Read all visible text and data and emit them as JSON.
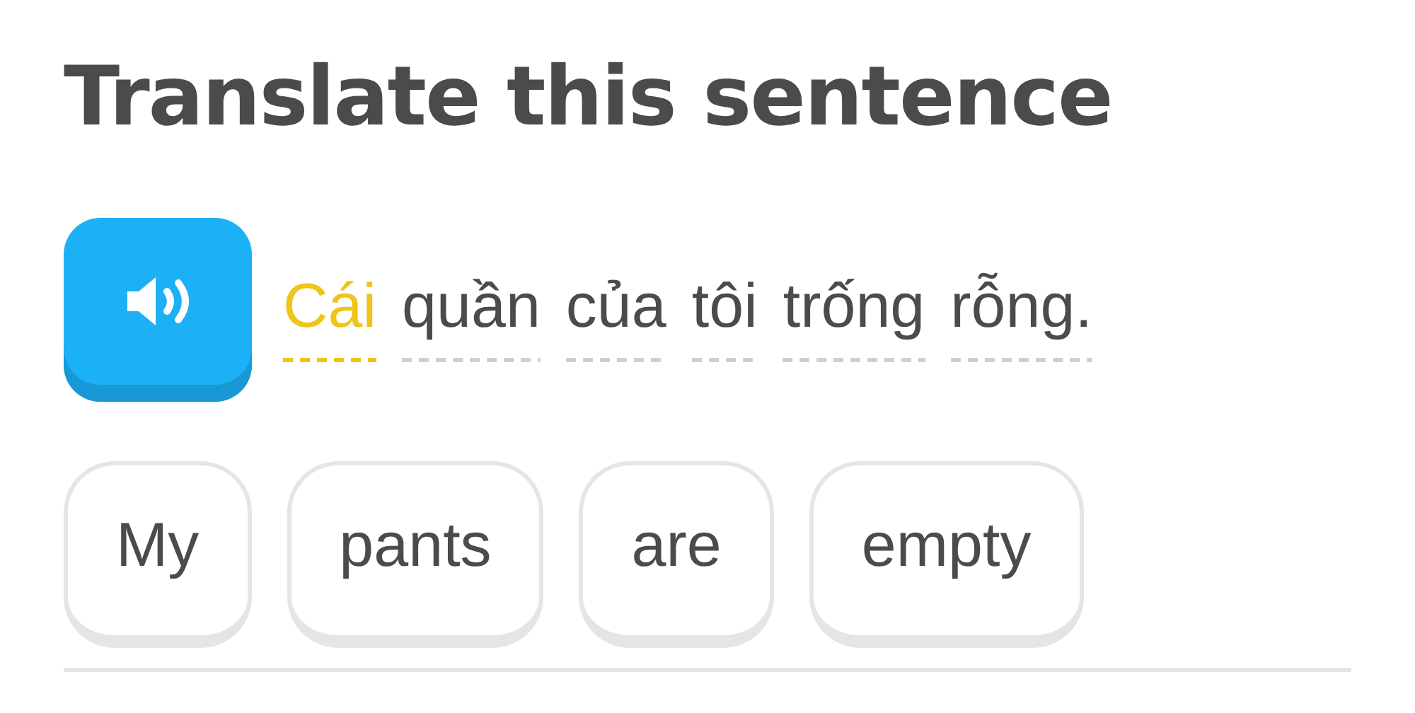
{
  "title": "Translate this sentence",
  "prompt": {
    "words": [
      {
        "text": "Cái",
        "selected": true
      },
      {
        "text": "quần",
        "selected": false
      },
      {
        "text": "của",
        "selected": false
      },
      {
        "text": "tôi",
        "selected": false
      },
      {
        "text": "trống",
        "selected": false
      },
      {
        "text": "rỗng.",
        "selected": false
      }
    ]
  },
  "answer": {
    "tiles": [
      "My",
      "pants",
      "are",
      "empty"
    ]
  }
}
